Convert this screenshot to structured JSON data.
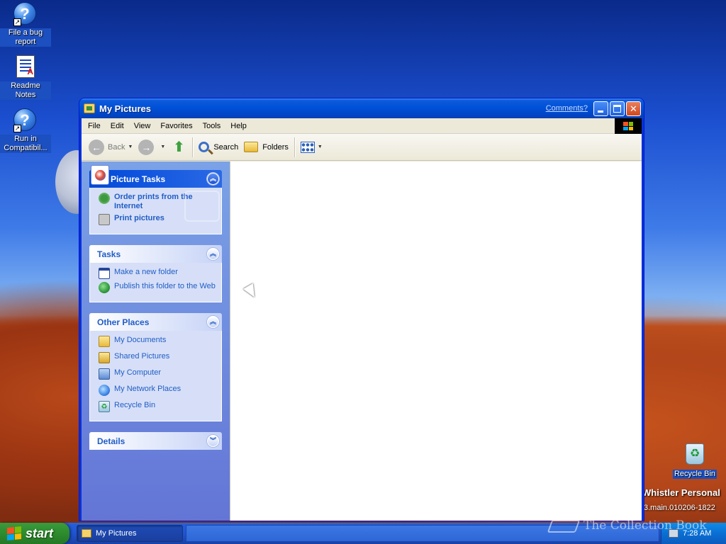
{
  "desktop": {
    "icons": [
      {
        "label": "File a bug report",
        "icon": "help-icon"
      },
      {
        "label": "Readme Notes",
        "icon": "document-icon"
      },
      {
        "label": "Run in Compatibil...",
        "icon": "help-icon"
      },
      {
        "label": "Recycle Bin",
        "icon": "recycle-bin-icon"
      }
    ],
    "branding": {
      "line1": "Whistler Personal",
      "line2": "3.main.010206-1822"
    },
    "watermark": "The Collection Book"
  },
  "window": {
    "title": "My Pictures",
    "comments_link": "Comments?",
    "menu": [
      "File",
      "Edit",
      "View",
      "Favorites",
      "Tools",
      "Help"
    ],
    "toolbar": {
      "back": "Back",
      "search": "Search",
      "folders": "Folders"
    },
    "taskpane": {
      "picture_tasks": {
        "title": "Picture Tasks",
        "items": [
          "Order prints from the Internet",
          "Print pictures"
        ]
      },
      "tasks": {
        "title": "Tasks",
        "items": [
          "Make a new folder",
          "Publish this folder to the Web"
        ]
      },
      "other_places": {
        "title": "Other Places",
        "items": [
          "My Documents",
          "Shared Pictures",
          "My Computer",
          "My Network Places",
          "Recycle Bin"
        ]
      },
      "details": {
        "title": "Details"
      }
    }
  },
  "taskbar": {
    "start_label": "start",
    "active_task": "My Pictures",
    "clock": "7:28 AM"
  },
  "colors": {
    "titlebar_blue": "#0051d8",
    "taskpane_blue": "#6375d6",
    "link_blue": "#215dc6",
    "start_green": "#2f8f2f"
  }
}
